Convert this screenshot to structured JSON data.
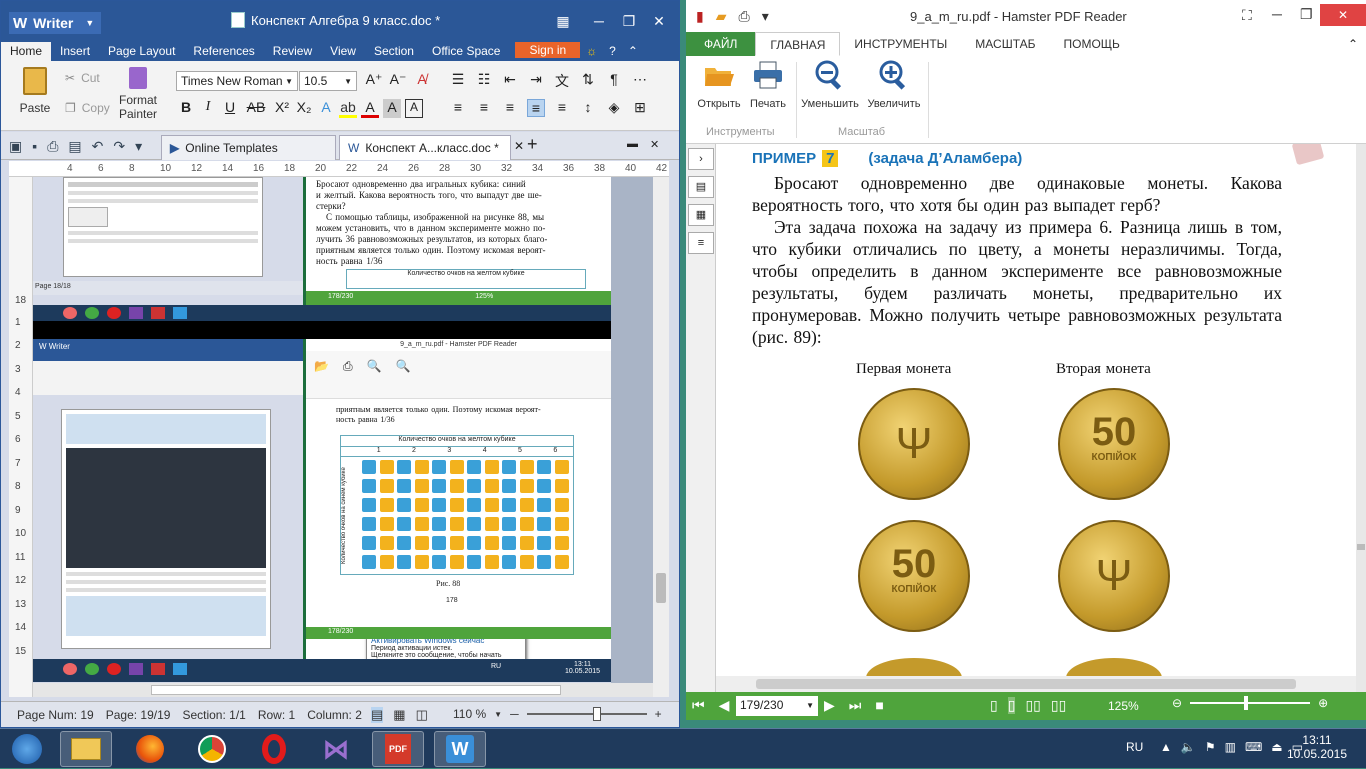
{
  "writer": {
    "app_name": "Writer",
    "doc_title": "Конспект Алгебра 9 класс.doc *",
    "menu": [
      "Home",
      "Insert",
      "Page Layout",
      "References",
      "Review",
      "View",
      "Section",
      "Office Space"
    ],
    "sign_in": "Sign in",
    "ribbon": {
      "paste": "Paste",
      "cut": "Cut",
      "copy": "Copy",
      "format_painter_1": "Format",
      "format_painter_2": "Painter",
      "font": "Times New Roman",
      "size": "10.5"
    },
    "tabs": {
      "online_templates": "Online Templates",
      "doc_tab": "Конспект А...класс.doc *"
    },
    "ruler_marks": [
      "4",
      "6",
      "8",
      "10",
      "12",
      "14",
      "16",
      "18",
      "20",
      "22",
      "24",
      "26",
      "28",
      "30",
      "32",
      "34",
      "36",
      "38",
      "40",
      "42"
    ],
    "vruler_marks": [
      "18",
      "1",
      "2",
      "3",
      "4",
      "5",
      "6",
      "7",
      "8",
      "9",
      "10",
      "11",
      "12",
      "13",
      "14",
      "15"
    ],
    "status": {
      "page_num": "Page Num: 19",
      "page": "Page: 19/19",
      "section": "Section: 1/1",
      "row": "Row: 1",
      "column": "Column: 2",
      "zoom": "110 %"
    },
    "embedded": {
      "top_text_1": "Бросают одновременно два игральных кубика: синий",
      "top_text_2": "и желтый. Какова вероятность того, что выпадут две ше-",
      "top_text_3": "стерки?",
      "top_text_4": "С помощью таблицы, изображенной на рисунке 88, мы",
      "top_text_5": "можем установить, что в данном эксперименте можно по-",
      "top_text_6": "лучить 36 равновозможных результатов, из которых благо-",
      "top_text_7": "приятным является только один. Поэтому искомая вероят-",
      "top_text_8": "ность равна",
      "fraction": "1/36",
      "table_title": "Количество очков на желтом кубике",
      "table_side": "Количество очков на синем кубике",
      "cols": [
        "1",
        "2",
        "3",
        "4",
        "5",
        "6"
      ],
      "fig": "Рис. 88",
      "pagenum": "178",
      "page_counter": "178/230",
      "zoom": "125%",
      "activate_title": "Активировать Windows сейчас",
      "activate_l1": "Период активации истек.",
      "activate_l2": "Щелкните это сообщение, чтобы начать активацию.",
      "inner_pdf_title": "9_a_m_ru.pdf - Hamster PDF Reader",
      "inner_page_counter": "178/230",
      "inner_time": "13:11",
      "inner_date": "10.05.2015",
      "inner_lang": "RU"
    }
  },
  "pdf": {
    "title": "9_a_m_ru.pdf - Hamster PDF Reader",
    "menu": [
      "ФАЙЛ",
      "ГЛАВНАЯ",
      "ИНСТРУМЕНТЫ",
      "МАСШТАБ",
      "ПОМОЩЬ"
    ],
    "buttons": {
      "open": "Открыть",
      "print": "Печать",
      "zoom_out": "Уменьшить",
      "zoom_in": "Увеличить"
    },
    "groups": {
      "tools": "Инструменты",
      "scale": "Масштаб"
    },
    "example_label": "ПРИМЕР",
    "example_num": "7",
    "example_sub": "(задача Д’Аламбера)",
    "para1": "Бросают одновременно две одинаковые монеты. Какова вероятность того, что хотя бы один раз выпадет герб?",
    "para2": "Эта задача похожа на задачу из примера 6. Разница лишь в том, что кубики отличались по цвету, а монеты неразличимы. Тогда, чтобы определить в данном эксперименте все равновозможные результаты, будем различать монеты, предварительно их пронумеровав. Можно получить четыре равновозможных результата (рис. 89):",
    "coin1": "Первая монета",
    "coin2": "Вторая монета",
    "coin_value": "50",
    "coin_unit": "КОПІЙОК",
    "page_counter": "179/230",
    "zoom": "125%"
  },
  "taskbar": {
    "lang": "RU",
    "time": "13:11",
    "date": "10.05.2015"
  },
  "colors": {
    "writer_blue": "#2b5797",
    "pdf_green": "#4fa43c",
    "example_blue": "#1a73b8",
    "example_yellow": "#f5c518",
    "coin_gold": "#c9a23a"
  }
}
